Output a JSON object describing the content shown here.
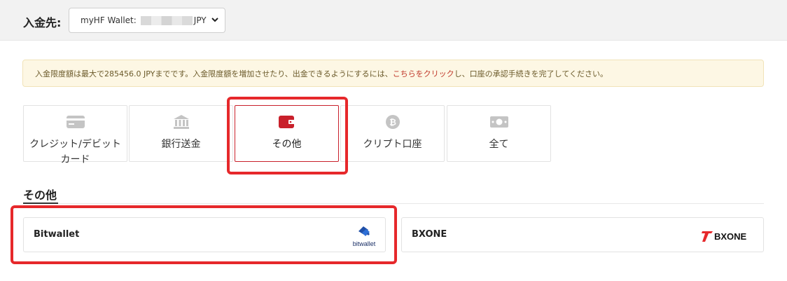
{
  "header": {
    "deposit_to_label": "入金先:",
    "wallet_prefix": "myHF Wallet:",
    "wallet_currency": "JPY"
  },
  "notice": {
    "text_before": "入金限度額は最大で285456.0 JPYまでです。入金限度額を増加させたり、出金できるようにするには、",
    "link": "こちらをクリック",
    "text_after": "し、口座の承認手続きを完了してください。",
    "link_color": "#c0392b"
  },
  "tabs": [
    {
      "label": "クレジット/デビットカード",
      "icon": "credit-card-icon",
      "selected": false
    },
    {
      "label": "銀行送金",
      "icon": "bank-icon",
      "selected": false
    },
    {
      "label": "その他",
      "icon": "wallet-icon",
      "selected": true
    },
    {
      "label": "クリプト口座",
      "icon": "bitcoin-icon",
      "selected": false
    },
    {
      "label": "全て",
      "icon": "cash-icon",
      "selected": false
    }
  ],
  "section": {
    "title": "その他"
  },
  "methods": [
    {
      "name": "Bitwallet",
      "logo_text": "bitwallet"
    },
    {
      "name": "BXONE",
      "logo_text": "BXONE"
    }
  ],
  "colors": {
    "accent": "#c9202b",
    "highlight": "#e6282b",
    "icon_gray": "#c4c4c4"
  }
}
